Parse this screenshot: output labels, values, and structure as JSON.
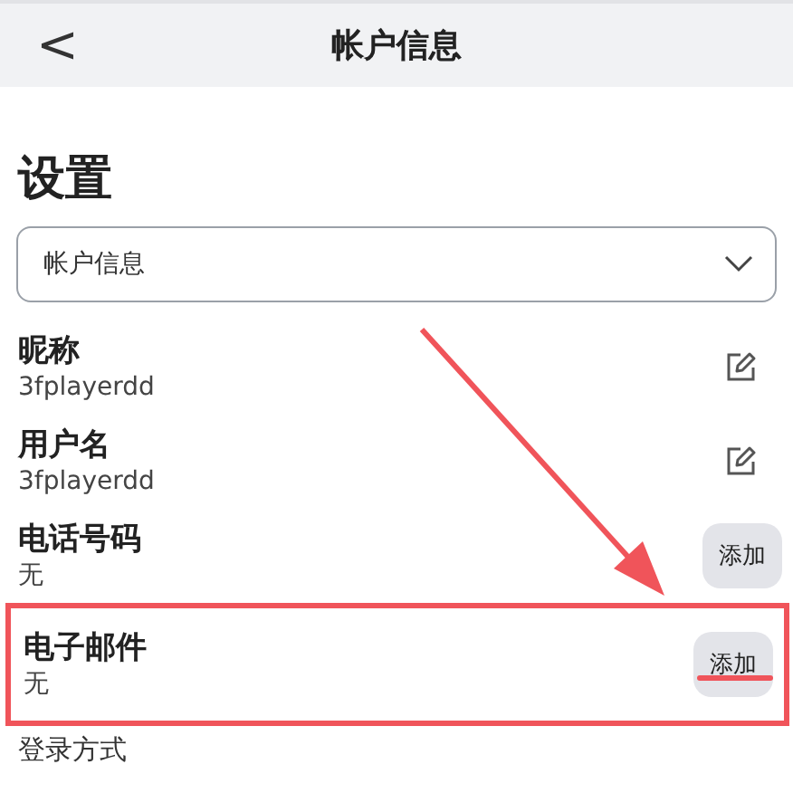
{
  "header": {
    "back": "<",
    "title": "帐户信息"
  },
  "heading": "设置",
  "select": {
    "value": "帐户信息"
  },
  "rows": [
    {
      "label": "昵称",
      "value": "3fplayerdd",
      "kind": "edit",
      "highlighted": false
    },
    {
      "label": "用户名",
      "value": "3fplayerdd",
      "kind": "edit",
      "highlighted": false
    },
    {
      "label": "电话号码",
      "value": "无",
      "kind": "add",
      "action": "添加",
      "highlighted": false
    },
    {
      "label": "电子邮件",
      "value": "无",
      "kind": "add",
      "action": "添加",
      "highlighted": true
    }
  ],
  "section": "登录方式",
  "annotation": {
    "arrow": true
  }
}
